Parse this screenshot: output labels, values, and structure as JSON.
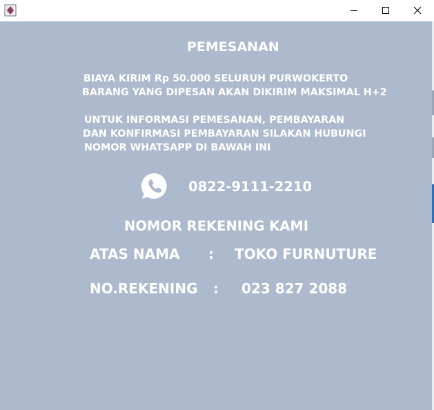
{
  "window": {
    "title": "",
    "controls": {
      "minimize_icon": "minimize-icon",
      "maximize_icon": "maximize-icon",
      "close_icon": "close-icon"
    }
  },
  "page": {
    "heading": "PEMESANAN",
    "shipping_lines": [
      "BIAYA KIRIM Rp 50.000 SELURUH PURWOKERTO",
      "BARANG YANG DIPESAN AKAN DIKIRIM MAKSIMAL H+2"
    ],
    "contact_lines": [
      "UNTUK INFORMASI PEMESANAN, PEMBAYARAN",
      "DAN KONFIRMASI PEMBAYARAN SILAKAN HUBUNGI",
      "NOMOR WHATSAPP DI BAWAH INI"
    ],
    "whatsapp": {
      "icon": "whatsapp-icon",
      "number": "0822-9111-2210"
    },
    "bank": {
      "heading": "NOMOR REKENING KAMI",
      "account_name_label": "ATAS NAMA",
      "account_name_colon": ":",
      "account_name": "TOKO FURNUTURE",
      "account_number_label": "NO.REKENING",
      "account_number_colon": ":",
      "account_number": "023 827 2088"
    }
  },
  "colors": {
    "background": "#adb9cc",
    "text": "#ffffff",
    "titlebar": "#ffffff"
  }
}
